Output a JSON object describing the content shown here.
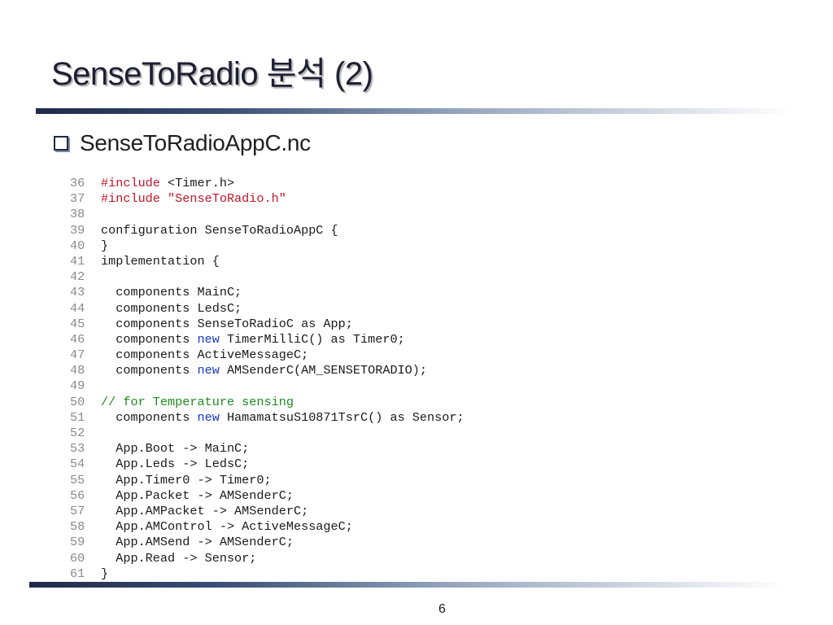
{
  "slide": {
    "title": "SenseToRadio 분석 (2)",
    "bullet": "SenseToRadioAppC.nc",
    "page_number": "6"
  },
  "colors": {
    "title_rule": "#1f2a4a",
    "preprocessor": "#c0142a",
    "keyword": "#1737c8",
    "comment": "#1f8a1f",
    "line_number": "#8a8a8a"
  },
  "code": {
    "lines": [
      {
        "num": "36",
        "tokens": [
          {
            "t": "pre",
            "v": "#include "
          },
          {
            "t": "plain",
            "v": "<Timer.h>"
          }
        ]
      },
      {
        "num": "37",
        "tokens": [
          {
            "t": "pre",
            "v": "#include "
          },
          {
            "t": "str",
            "v": "\"SenseToRadio.h\""
          }
        ]
      },
      {
        "num": "38",
        "tokens": []
      },
      {
        "num": "39",
        "tokens": [
          {
            "t": "plain",
            "v": "configuration SenseToRadioAppC {"
          }
        ]
      },
      {
        "num": "40",
        "tokens": [
          {
            "t": "plain",
            "v": "}"
          }
        ]
      },
      {
        "num": "41",
        "tokens": [
          {
            "t": "plain",
            "v": "implementation {"
          }
        ]
      },
      {
        "num": "42",
        "tokens": []
      },
      {
        "num": "43",
        "tokens": [
          {
            "t": "plain",
            "v": "  components MainC;"
          }
        ]
      },
      {
        "num": "44",
        "tokens": [
          {
            "t": "plain",
            "v": "  components LedsC;"
          }
        ]
      },
      {
        "num": "45",
        "tokens": [
          {
            "t": "plain",
            "v": "  components SenseToRadioC as App;"
          }
        ]
      },
      {
        "num": "46",
        "tokens": [
          {
            "t": "plain",
            "v": "  components "
          },
          {
            "t": "kw",
            "v": "new"
          },
          {
            "t": "plain",
            "v": " TimerMilliC() as Timer0;"
          }
        ]
      },
      {
        "num": "47",
        "tokens": [
          {
            "t": "plain",
            "v": "  components ActiveMessageC;"
          }
        ]
      },
      {
        "num": "48",
        "tokens": [
          {
            "t": "plain",
            "v": "  components "
          },
          {
            "t": "kw",
            "v": "new"
          },
          {
            "t": "plain",
            "v": " AMSenderC(AM_SENSETORADIO);"
          }
        ]
      },
      {
        "num": "49",
        "tokens": []
      },
      {
        "num": "50",
        "tokens": [
          {
            "t": "cmt",
            "v": "// for Temperature sensing"
          }
        ]
      },
      {
        "num": "51",
        "tokens": [
          {
            "t": "plain",
            "v": "  components "
          },
          {
            "t": "kw",
            "v": "new"
          },
          {
            "t": "plain",
            "v": " HamamatsuS10871TsrC() as Sensor;"
          }
        ]
      },
      {
        "num": "52",
        "tokens": []
      },
      {
        "num": "53",
        "tokens": [
          {
            "t": "plain",
            "v": "  App.Boot -> MainC;"
          }
        ]
      },
      {
        "num": "54",
        "tokens": [
          {
            "t": "plain",
            "v": "  App.Leds -> LedsC;"
          }
        ]
      },
      {
        "num": "55",
        "tokens": [
          {
            "t": "plain",
            "v": "  App.Timer0 -> Timer0;"
          }
        ]
      },
      {
        "num": "56",
        "tokens": [
          {
            "t": "plain",
            "v": "  App.Packet -> AMSenderC;"
          }
        ]
      },
      {
        "num": "57",
        "tokens": [
          {
            "t": "plain",
            "v": "  App.AMPacket -> AMSenderC;"
          }
        ]
      },
      {
        "num": "58",
        "tokens": [
          {
            "t": "plain",
            "v": "  App.AMControl -> ActiveMessageC;"
          }
        ]
      },
      {
        "num": "59",
        "tokens": [
          {
            "t": "plain",
            "v": "  App.AMSend -> AMSenderC;"
          }
        ]
      },
      {
        "num": "60",
        "tokens": [
          {
            "t": "plain",
            "v": "  App.Read -> Sensor;"
          }
        ]
      },
      {
        "num": "61",
        "tokens": [
          {
            "t": "plain",
            "v": "}"
          }
        ]
      }
    ]
  }
}
